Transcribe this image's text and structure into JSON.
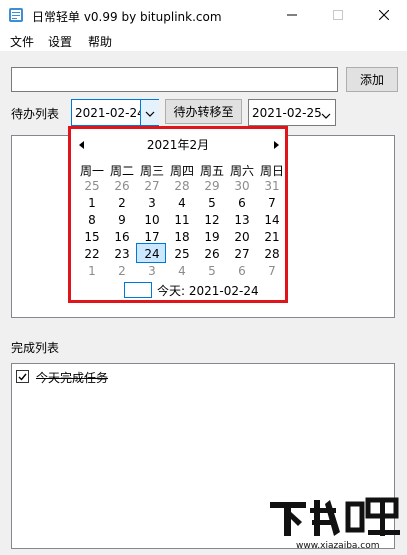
{
  "window": {
    "title": "日常轻单 v0.99 by bituplink.com",
    "icons": {
      "app": "notepad-icon",
      "minimize": "minimize-icon",
      "maximize": "maximize-icon",
      "close": "close-icon"
    }
  },
  "menu": {
    "file": "文件",
    "settings": "设置",
    "help": "帮助"
  },
  "task_input": {
    "value": "",
    "placeholder": ""
  },
  "add_button": "添加",
  "todo": {
    "label": "待办列表",
    "from_date": "2021-02-24",
    "move_button": "待办转移至",
    "to_date": "2021-02-25",
    "items": []
  },
  "calendar": {
    "month_label": "2021年2月",
    "weekdays": [
      "周一",
      "周二",
      "周三",
      "周四",
      "周五",
      "周六",
      "周日"
    ],
    "days": [
      [
        "25",
        "26",
        "27",
        "28",
        "29",
        "30",
        "31"
      ],
      [
        "1",
        "2",
        "3",
        "4",
        "5",
        "6",
        "7"
      ],
      [
        "8",
        "9",
        "10",
        "11",
        "12",
        "13",
        "14"
      ],
      [
        "15",
        "16",
        "17",
        "18",
        "19",
        "20",
        "21"
      ],
      [
        "22",
        "23",
        "24",
        "25",
        "26",
        "27",
        "28"
      ],
      [
        "1",
        "2",
        "3",
        "4",
        "5",
        "6",
        "7"
      ]
    ],
    "selected": "24",
    "today_text": "今天: 2021-02-24",
    "highlight_color": "#e0141b"
  },
  "done": {
    "label": "完成列表",
    "items": [
      {
        "text": "今天完成任务",
        "checked": true
      }
    ]
  },
  "watermark": {
    "logo": "下载吧",
    "url": "www.xiazaiba.com"
  }
}
